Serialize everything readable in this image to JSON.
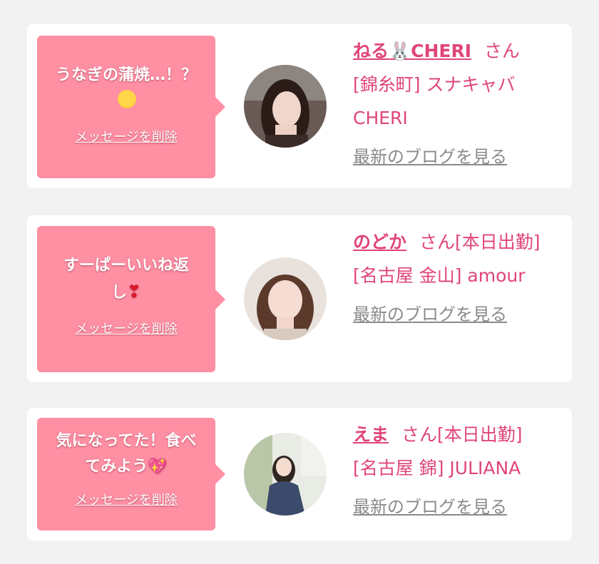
{
  "items": [
    {
      "message": "うなぎの蒲焼…！？",
      "message_emoji": "pleading-face-icon",
      "delete_label": "メッセージを削除",
      "name": "ねる🐰CHERI",
      "san": "さん",
      "shop": "[錦糸町] スナキャバCHERI",
      "blog_label": "最新のブログを見る"
    },
    {
      "message": "すーぱーいいね返し",
      "message_emoji": "heart-exclamation-icon",
      "delete_label": "メッセージを削除",
      "name": "のどか",
      "san": "さん[本日出勤]",
      "shop": "[名古屋 金山] amour",
      "blog_label": "最新のブログを見る"
    },
    {
      "message": "気になってた！食べてみよう",
      "message_emoji": "sparkling-heart-icon",
      "delete_label": "メッセージを削除",
      "name": "えま",
      "san": "さん[本日出勤]",
      "shop": "[名古屋 錦] JULIANA",
      "blog_label": "最新のブログを見る"
    }
  ],
  "colors": {
    "background": "#f2f2f2",
    "bubble": "#ff8fa3",
    "accent": "#e0457b",
    "link_gray": "#8a8a8a"
  }
}
